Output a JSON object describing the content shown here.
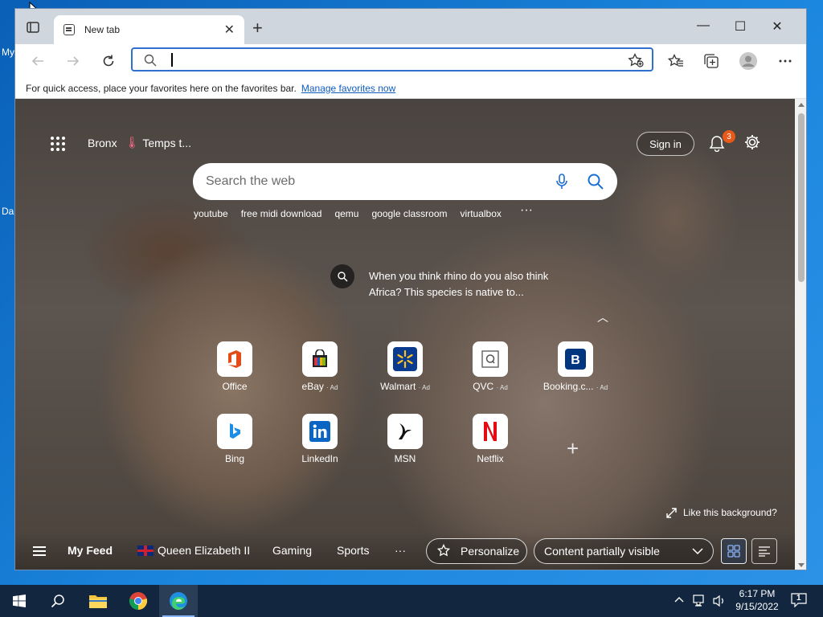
{
  "desktop": {
    "icon_labels": [
      "My",
      "Da"
    ]
  },
  "browser": {
    "tab": {
      "title": "New tab",
      "close": "✕"
    },
    "new_tab": "+",
    "window_controls": {
      "minimize": "—",
      "maximize": "☐",
      "close": "✕"
    },
    "address_bar": {
      "value": "",
      "placeholder": ""
    },
    "favorites_bar": {
      "text": "For quick access, place your favorites here on the favorites bar.",
      "link": "Manage favorites now"
    }
  },
  "newtab": {
    "weather": {
      "location": "Bronx",
      "temp": "Temps t..."
    },
    "sign_in": "Sign in",
    "notifications_count": "3",
    "search": {
      "placeholder": "Search the web"
    },
    "trending": [
      "youtube",
      "free midi download",
      "qemu",
      "google classroom",
      "virtualbox"
    ],
    "trending_more": "···",
    "background_fact": "When you think rhino do you also think Africa? This species is native to...",
    "quick_links": [
      {
        "name": "Office",
        "ad": "",
        "color": "#e34b17"
      },
      {
        "name": "eBay",
        "ad": "· Ad",
        "color": "#333333"
      },
      {
        "name": "Walmart",
        "ad": "· Ad",
        "color": "#0b3b8f"
      },
      {
        "name": "QVC",
        "ad": "· Ad",
        "color": "#555555"
      },
      {
        "name": "Booking.c...",
        "ad": "· Ad",
        "color": "#003580"
      },
      {
        "name": "Bing",
        "ad": "",
        "color": "#1c8ce6"
      },
      {
        "name": "LinkedIn",
        "ad": "",
        "color": "#0a66c2"
      },
      {
        "name": "MSN",
        "ad": "",
        "color": "#111111"
      },
      {
        "name": "Netflix",
        "ad": "",
        "color": "#e50914"
      }
    ],
    "like_background": "Like this background?",
    "feed": {
      "my_feed": "My Feed",
      "items": [
        "Queen Elizabeth II",
        "Gaming",
        "Sports"
      ],
      "more": "···",
      "personalize": "Personalize",
      "content_visibility": "Content partially visible"
    }
  },
  "taskbar": {
    "time": "6:17 PM",
    "date": "9/15/2022",
    "notification_count": "1"
  }
}
